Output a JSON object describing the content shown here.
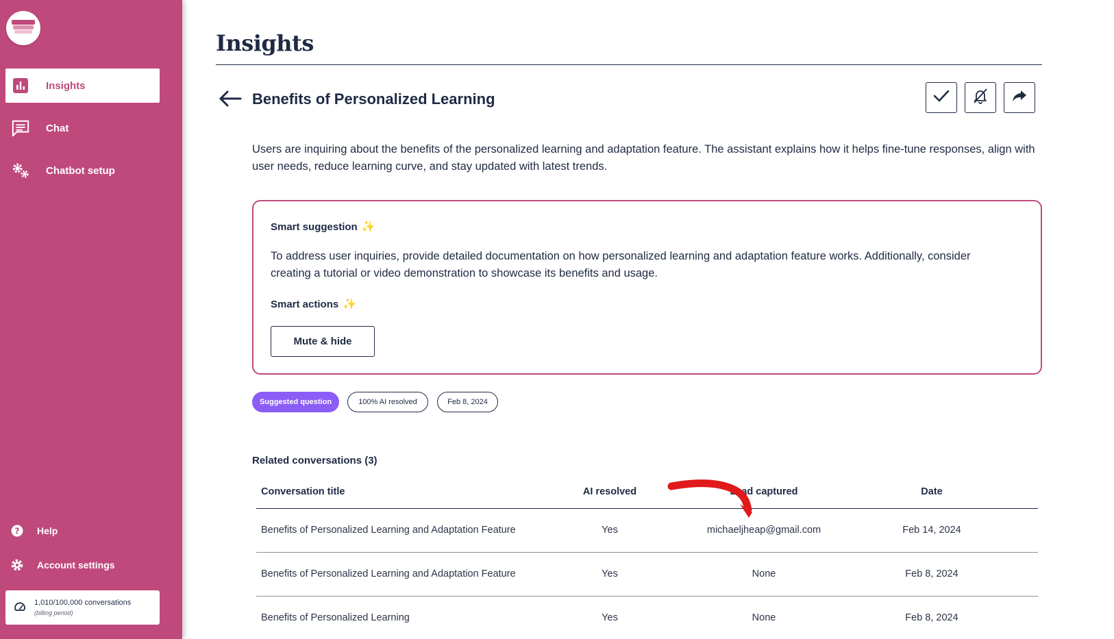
{
  "sidebar": {
    "items": [
      {
        "label": "Insights",
        "icon": "bar-chart-icon",
        "active": true
      },
      {
        "label": "Chat",
        "icon": "chat-icon",
        "active": false
      },
      {
        "label": "Chatbot setup",
        "icon": "gears-icon",
        "active": false
      }
    ],
    "footer": [
      {
        "label": "Help",
        "icon": "help-icon"
      },
      {
        "label": "Account settings",
        "icon": "gear-icon"
      }
    ],
    "usage": {
      "count": "1,010/100,000 conversations",
      "period": "(billing period)"
    }
  },
  "page": {
    "title": "Insights"
  },
  "insight": {
    "title": "Benefits of Personalized Learning",
    "summary": "Users are inquiring about the benefits of the personalized learning and adaptation feature. The assistant explains how it helps fine-tune responses, align with user needs, reduce learning curve, and stay updated with latest trends.",
    "actions": [
      "check-icon",
      "bell-off-icon",
      "share-icon"
    ]
  },
  "suggestion": {
    "smart_suggestion_label": "Smart suggestion",
    "text": "To address user inquiries, provide detailed documentation on how personalized learning and adaptation feature works. Additionally, consider creating a tutorial or video demonstration to showcase its benefits and usage.",
    "smart_actions_label": "Smart actions",
    "mute_button": "Mute & hide",
    "sparkle": "✨"
  },
  "tags": [
    "Suggested question",
    "100% AI resolved",
    "Feb 8, 2024"
  ],
  "related": {
    "label": "Related conversations (3)",
    "columns": [
      "Conversation title",
      "AI resolved",
      "Lead captured",
      "Date"
    ],
    "rows": [
      [
        "Benefits of Personalized Learning and Adaptation Feature",
        "Yes",
        "michaeljheap@gmail.com",
        "Feb 14, 2024"
      ],
      [
        "Benefits of Personalized Learning and Adaptation Feature",
        "Yes",
        "None",
        "Feb 8, 2024"
      ],
      [
        "Benefits of Personalized Learning",
        "Yes",
        "None",
        "Feb 8, 2024"
      ]
    ]
  },
  "colors": {
    "brand": "#c0497c",
    "accent_purple": "#8b5cf6",
    "text": "#1f2a44",
    "annotation_red": "#e0191b"
  }
}
